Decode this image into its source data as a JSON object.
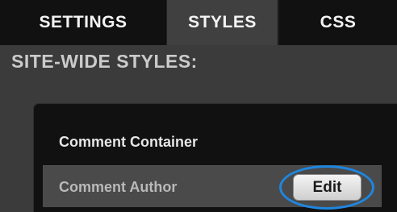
{
  "tabs": {
    "settings": "SETTINGS",
    "styles": "STYLES",
    "css": "CSS"
  },
  "section": {
    "title": "SITE-WIDE STYLES:"
  },
  "items": [
    {
      "label": "Comment Container"
    },
    {
      "label": "Comment Author",
      "button": "Edit"
    }
  ],
  "colors": {
    "highlight_ring": "#1f86df",
    "active_tab": "#404040"
  }
}
